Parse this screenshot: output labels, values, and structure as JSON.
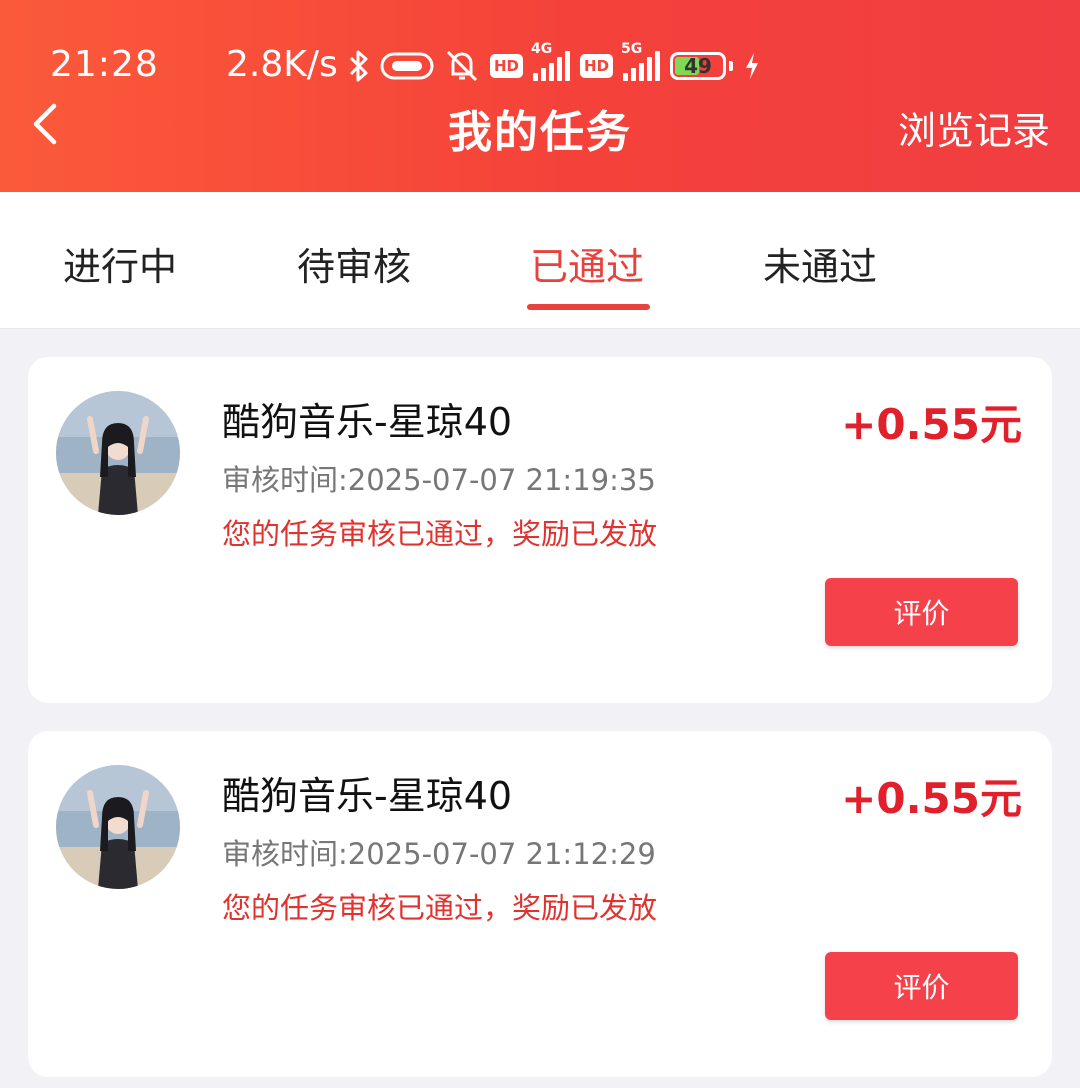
{
  "status_bar": {
    "time": "21:28",
    "net_speed": "2.8K/s",
    "sim1_badge": "HD",
    "sim1_generation": "4G",
    "sim2_badge": "HD",
    "sim2_generation": "5G",
    "battery_level": "49",
    "icons": [
      "bluetooth-icon",
      "link-icon",
      "mute-bell-icon",
      "signal-icon",
      "signal-icon",
      "battery-icon",
      "charging-icon"
    ]
  },
  "header": {
    "title": "我的任务",
    "right_link": "浏览记录",
    "back_icon": "chevron-left-icon"
  },
  "tabs": [
    {
      "label": "进行中",
      "active": false
    },
    {
      "label": "待审核",
      "active": false
    },
    {
      "label": "已通过",
      "active": true
    },
    {
      "label": "未通过",
      "active": false
    }
  ],
  "tasks": [
    {
      "name": "酷狗音乐-星琼40",
      "review_time": "审核时间:2025-07-07 21:19:35",
      "status_message": "您的任务审核已通过，奖励已发放",
      "reward": "+0.55元",
      "button_label": "评价"
    },
    {
      "name": "酷狗音乐-星琼40",
      "review_time": "审核时间:2025-07-07 21:12:29",
      "status_message": "您的任务审核已通过，奖励已发放",
      "reward": "+0.55元",
      "button_label": "评价"
    }
  ],
  "colors": {
    "header_start": "#fb5a3a",
    "header_end": "#f03e42",
    "accent": "#e8423e",
    "reward": "#e0202b",
    "button": "#f4414a",
    "background": "#f2f2f6"
  }
}
